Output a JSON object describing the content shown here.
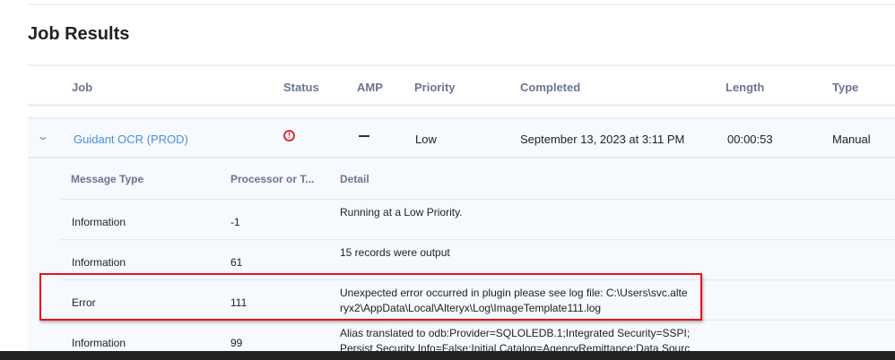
{
  "page_title": "Job Results",
  "columns": [
    "Job",
    "Status",
    "AMP",
    "Priority",
    "Completed",
    "Length",
    "Type"
  ],
  "job": {
    "name": "Guidant OCR (PROD)",
    "status_icon": "error-circle-icon",
    "status_color": "#e0303a",
    "amp": "—",
    "priority": "Low",
    "completed": "September 13, 2023 at 3:11 PM",
    "length": "00:00:53",
    "type": "Manual"
  },
  "messages": {
    "columns": [
      "Message Type",
      "Processor or T...",
      "Detail"
    ],
    "rows": [
      {
        "type": "Information",
        "processor": "-1",
        "detail": [
          "Running at a Low Priority."
        ]
      },
      {
        "type": "Information",
        "processor": "61",
        "detail": [
          "15 records were output"
        ]
      },
      {
        "type": "Error",
        "processor": "111",
        "detail": [
          "Unexpected error occurred in plugin please see log file: C:\\Users\\svc.alte",
          "ryx2\\AppData\\Local\\Alteryx\\Log\\ImageTemplate111.log"
        ]
      },
      {
        "type": "Information",
        "processor": "99",
        "detail": [
          "Alias translated to odb:Provider=SQLOLEDB.1;Integrated Security=SSPI;",
          "Persist Security Info=False;Initial Catalog=AgencyRemittance;Data Sourc"
        ]
      }
    ]
  }
}
